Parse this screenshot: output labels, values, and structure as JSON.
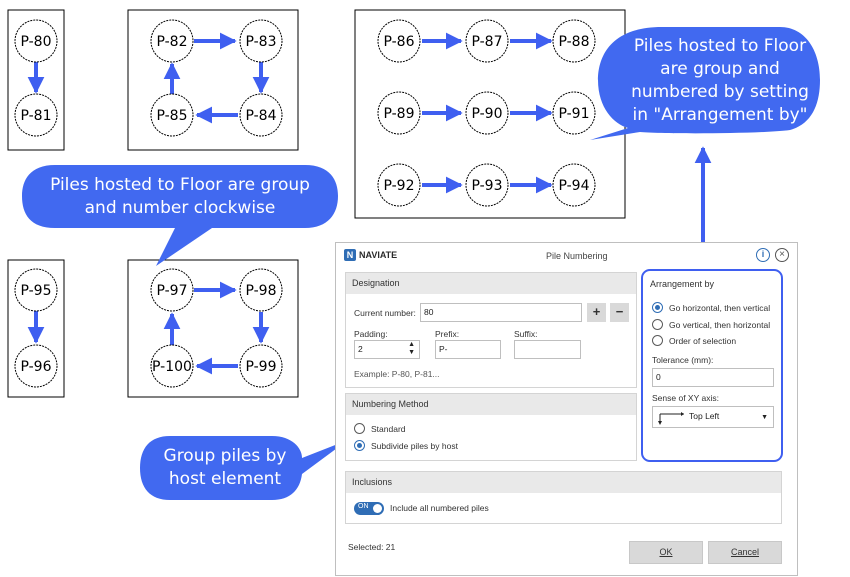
{
  "piles": [
    "P-80",
    "P-81",
    "P-82",
    "P-83",
    "P-84",
    "P-85",
    "P-86",
    "P-87",
    "P-88",
    "P-89",
    "P-90",
    "P-91",
    "P-92",
    "P-93",
    "P-94",
    "P-95",
    "P-96",
    "P-97",
    "P-98",
    "P-99",
    "P-100"
  ],
  "callouts": {
    "arrangement_by_setting": "Piles hosted to Floor are group and numbered by setting in \"Arrangement by\"",
    "clockwise": "Piles hosted to Floor are group and number clockwise",
    "group_by_host": "Group piles by host element"
  },
  "colors": {
    "callout_fill": "#4169f0",
    "arrow": "#3f5ff0",
    "accent": "#2f6db5"
  },
  "dialog": {
    "logo_letter": "N",
    "brand": "NAVIATE",
    "title": "Pile Numbering",
    "info_icon": "info-icon",
    "close_icon": "close-icon",
    "designation": {
      "header": "Designation",
      "current_number_label": "Current number:",
      "current_number_value": "80",
      "plus": "+",
      "minus": "−",
      "padding_label": "Padding:",
      "padding_value": "2",
      "prefix_label": "Prefix:",
      "prefix_value": "P-",
      "suffix_label": "Suffix:",
      "suffix_value": "",
      "example": "Example: P-80, P-81..."
    },
    "numbering_method": {
      "header": "Numbering Method",
      "standard": "Standard",
      "subdivide": "Subdivide piles by host",
      "selected": "Subdivide piles by host"
    },
    "arrangement": {
      "header": "Arrangement by",
      "options": [
        "Go horizontal, then vertical",
        "Go vertical, then horizontal",
        "Order of selection"
      ],
      "selected": "Go horizontal, then vertical",
      "tolerance_label": "Tolerance (mm):",
      "tolerance_value": "0",
      "sense_label": "Sense of XY axis:",
      "sense_value": "Top Left"
    },
    "inclusions": {
      "header": "Inclusions",
      "toggle_text": "ON",
      "include_label": "Include all numbered piles"
    },
    "selected_text": "Selected: 21",
    "ok_label": "OK",
    "cancel_label": "Cancel"
  }
}
